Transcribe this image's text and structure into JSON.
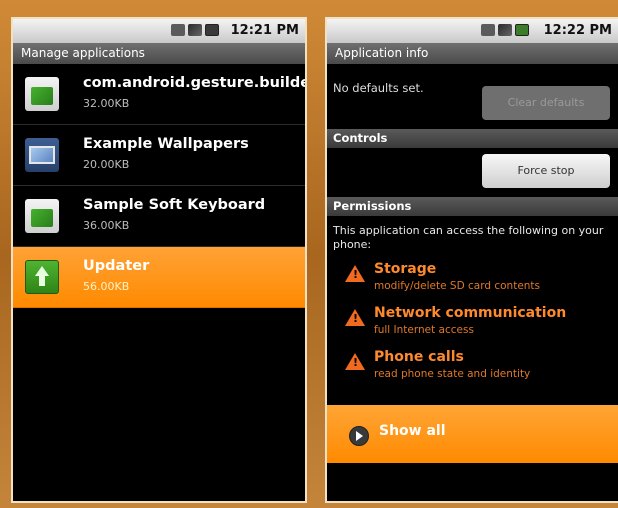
{
  "left": {
    "status_time": "12:21 PM",
    "title": "Manage applications",
    "apps": [
      {
        "name": "com.android.gesture.builder",
        "size": "32.00KB",
        "icon": "gesture-builder-icon"
      },
      {
        "name": "Example Wallpapers",
        "size": "20.00KB",
        "icon": "wallpapers-icon"
      },
      {
        "name": "Sample Soft Keyboard",
        "size": "36.00KB",
        "icon": "keyboard-icon"
      },
      {
        "name": "Updater",
        "size": "56.00KB",
        "icon": "updater-icon",
        "selected": true
      }
    ]
  },
  "right": {
    "status_time": "12:22 PM",
    "title": "Application info",
    "defaults_text": "No defaults set.",
    "clear_defaults_label": "Clear defaults",
    "controls_header": "Controls",
    "force_stop_label": "Force stop",
    "permissions_header": "Permissions",
    "permissions_intro": "This application can access the following on your phone:",
    "permissions": [
      {
        "title": "Storage",
        "desc": "modify/delete SD card contents"
      },
      {
        "title": "Network communication",
        "desc": "full Internet access"
      },
      {
        "title": "Phone calls",
        "desc": "read phone state and identity"
      }
    ],
    "show_all_label": "Show all"
  },
  "colors": {
    "accent_orange": "#ff8a00",
    "permission_text": "#ff8a2c",
    "warning_icon": "#f06b1f"
  }
}
